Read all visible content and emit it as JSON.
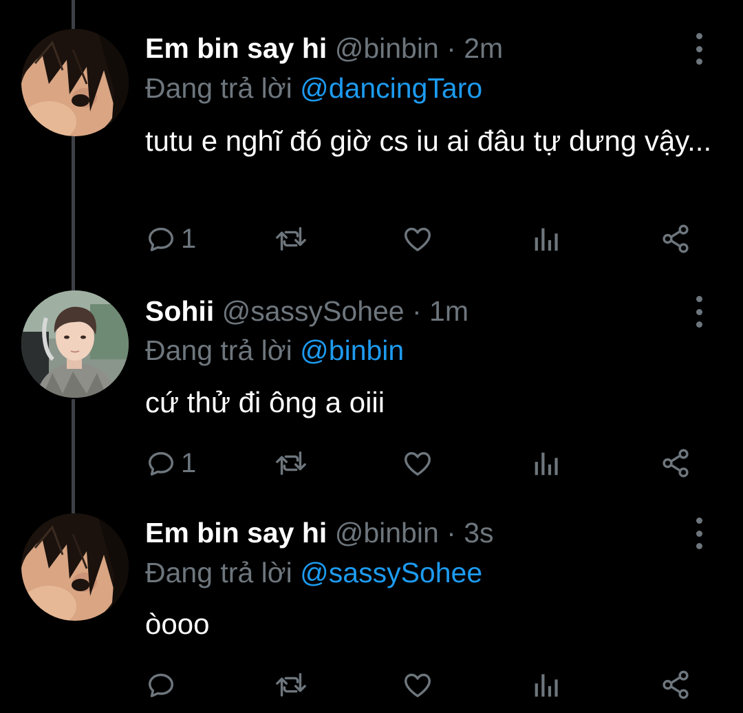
{
  "colors": {
    "background": "#000000",
    "text_primary": "#ffffff",
    "text_secondary": "#6e767d",
    "accent": "#1d9bf0",
    "thread_line": "#3d4146"
  },
  "icons": {
    "more": "more-vertical-icon",
    "reply": "reply-icon",
    "retweet": "retweet-icon",
    "like": "heart-icon",
    "analytics": "analytics-icon",
    "share": "share-icon"
  },
  "tweets": [
    {
      "display_name": "Em bin say hi",
      "handle_time": "@binbin · 2m",
      "reply_prefix": "Đang trả lời",
      "reply_to": "@dancingTaro",
      "text": "tutu e nghĩ đó giờ cs iu ai đâu tự dưng vậy...",
      "reply_count": "1"
    },
    {
      "display_name": "Sohii",
      "handle_time": "@sassySohee · 1m",
      "reply_prefix": "Đang trả lời",
      "reply_to": "@binbin",
      "text": "cứ thử đi ông a oiii",
      "reply_count": "1"
    },
    {
      "display_name": "Em bin say hi",
      "handle_time": "@binbin · 3s",
      "reply_prefix": "Đang trả lời",
      "reply_to": "@sassySohee",
      "text": "òooo",
      "reply_count": ""
    }
  ]
}
